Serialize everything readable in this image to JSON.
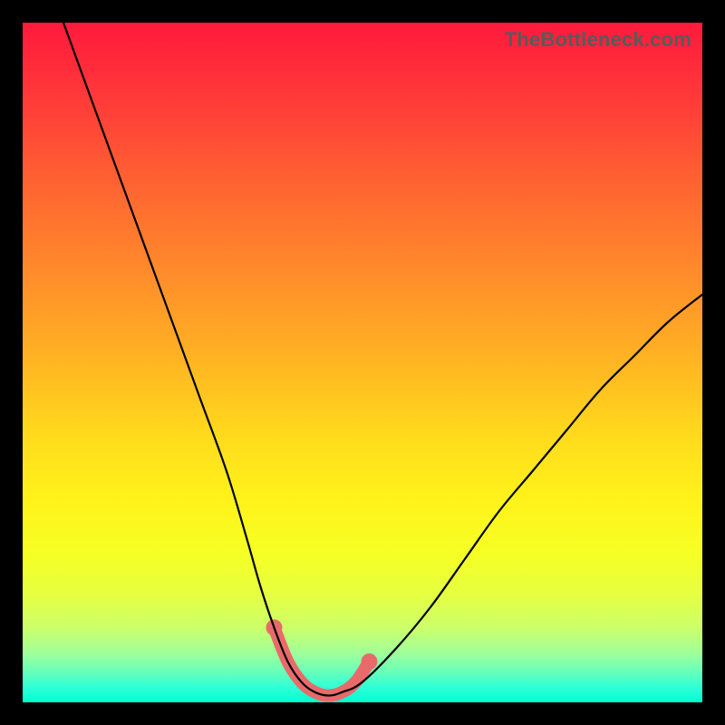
{
  "watermark": "TheBottleneck.com",
  "colors": {
    "background": "#000000",
    "curve": "#000000",
    "accent": "#e86a6a",
    "gradient_top": "#ff1a3c",
    "gradient_bottom": "#00ffcc"
  },
  "chart_data": {
    "type": "line",
    "title": "",
    "xlabel": "",
    "ylabel": "",
    "xlim": [
      0,
      100
    ],
    "ylim": [
      0,
      100
    ],
    "grid": false,
    "legend": false,
    "series": [
      {
        "name": "bottleneck-curve",
        "x": [
          6,
          10,
          14,
          18,
          22,
          26,
          30,
          33,
          35,
          37,
          39,
          41,
          43,
          45,
          47,
          50,
          55,
          60,
          65,
          70,
          75,
          80,
          85,
          90,
          95,
          100
        ],
        "y": [
          100,
          89,
          78,
          67,
          56,
          45,
          34,
          24,
          17,
          11,
          6,
          3,
          1.5,
          1,
          1.5,
          3,
          8,
          14,
          21,
          28,
          34,
          40,
          46,
          51,
          56,
          60
        ]
      }
    ],
    "highlight": {
      "name": "optimal-range",
      "x": [
        37,
        39,
        41,
        43,
        45,
        47,
        49,
        51
      ],
      "y": [
        11,
        6,
        3,
        1.5,
        1,
        1.5,
        3,
        6
      ]
    },
    "annotations": []
  }
}
